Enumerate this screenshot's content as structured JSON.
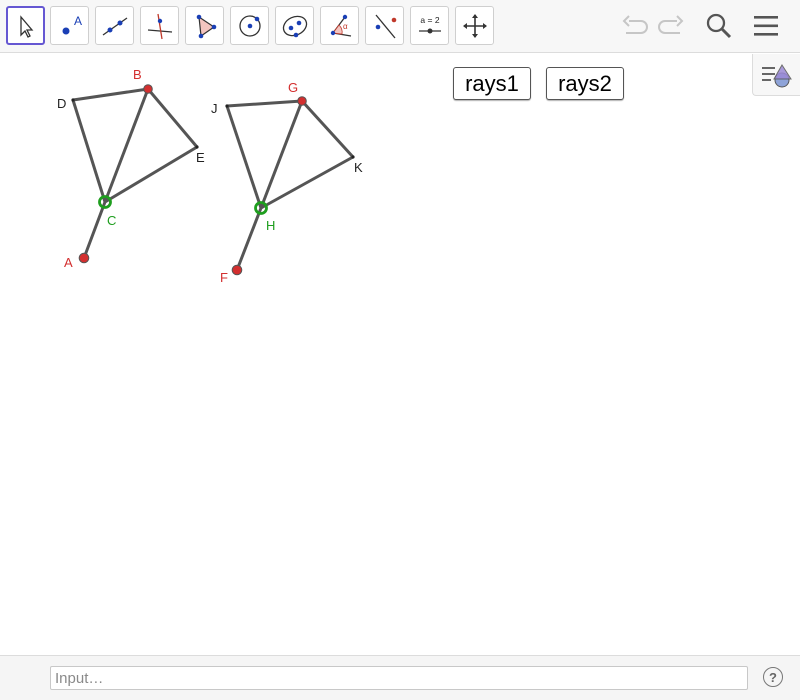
{
  "toolbar": {
    "tools": [
      {
        "name": "move-tool",
        "label": ""
      },
      {
        "name": "point-tool",
        "label": "A"
      },
      {
        "name": "line-tool",
        "label": ""
      },
      {
        "name": "perpendicular-tool",
        "label": ""
      },
      {
        "name": "polygon-tool",
        "label": ""
      },
      {
        "name": "circle-tool",
        "label": ""
      },
      {
        "name": "conic-tool",
        "label": ""
      },
      {
        "name": "angle-tool",
        "label": "α"
      },
      {
        "name": "reflect-tool",
        "label": ""
      },
      {
        "name": "slider-tool",
        "label": "a = 2"
      },
      {
        "name": "move-view-tool",
        "label": ""
      }
    ],
    "active_tool": "move-tool"
  },
  "colors": {
    "accent": "#6557d2",
    "free_point": "#d32f2f",
    "dependent_point": "#1e9e1e",
    "segment": "#555555",
    "label_black": "#222222"
  },
  "buttons": {
    "rays1": "rays1",
    "rays2": "rays2"
  },
  "figure1": {
    "labels": {
      "A": "A",
      "B": "B",
      "C": "C",
      "D": "D",
      "E": "E"
    }
  },
  "figure2": {
    "labels": {
      "F": "F",
      "G": "G",
      "H": "H",
      "J": "J",
      "K": "K"
    }
  },
  "inputbar": {
    "placeholder": "Input…",
    "help": "?"
  }
}
